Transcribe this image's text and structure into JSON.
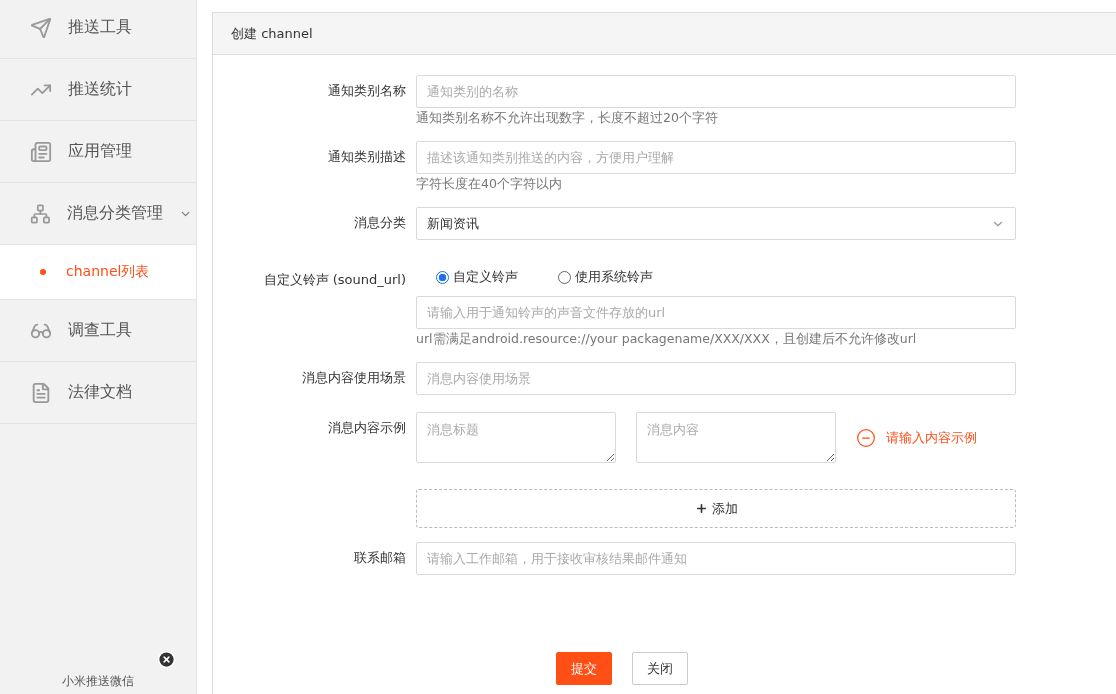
{
  "sidebar": {
    "items": [
      {
        "label": "推送工具"
      },
      {
        "label": "推送统计"
      },
      {
        "label": "应用管理"
      },
      {
        "label": "消息分类管理",
        "expanded": true,
        "children": [
          {
            "label": "channel列表",
            "selected": true
          }
        ]
      },
      {
        "label": "调查工具"
      },
      {
        "label": "法律文档"
      }
    ],
    "footer": {
      "label": "小米推送微信"
    }
  },
  "panel": {
    "title": "创建 channel",
    "fields": [
      {
        "kind": "input",
        "label": "通知类别名称",
        "placeholder": "通知类别的名称",
        "hint": "通知类别名称不允许出现数字，长度不超过20个字符"
      },
      {
        "kind": "input",
        "label": "通知类别描述",
        "placeholder": "描述该通知类别推送的内容，方便用户理解",
        "hint": "字符长度在40个字符以内"
      },
      {
        "kind": "select",
        "label": "消息分类",
        "value": "新闻资讯"
      },
      {
        "kind": "sound",
        "label": "自定义铃声 (sound_url)",
        "options": [
          {
            "label": "自定义铃声",
            "selected": true
          },
          {
            "label": "使用系统铃声",
            "selected": false
          }
        ],
        "placeholder": "请输入用于通知铃声的声音文件存放的url",
        "hint": "url需满足android.resource://your packagename/XXX/XXX，且创建后不允许修改url"
      },
      {
        "kind": "input",
        "label": "消息内容使用场景",
        "placeholder": "消息内容使用场景"
      },
      {
        "kind": "examples",
        "label": "消息内容示例",
        "title_placeholder": "消息标题",
        "content_placeholder": "消息内容",
        "error": "请输入内容示例"
      },
      {
        "kind": "add",
        "button": "添加"
      },
      {
        "kind": "input",
        "label": "联系邮箱",
        "placeholder": "请输入工作邮箱，用于接收审核结果邮件通知"
      }
    ],
    "buttons": [
      {
        "kind": "primary",
        "label": "提交"
      },
      {
        "kind": "default",
        "label": "关闭"
      }
    ]
  }
}
